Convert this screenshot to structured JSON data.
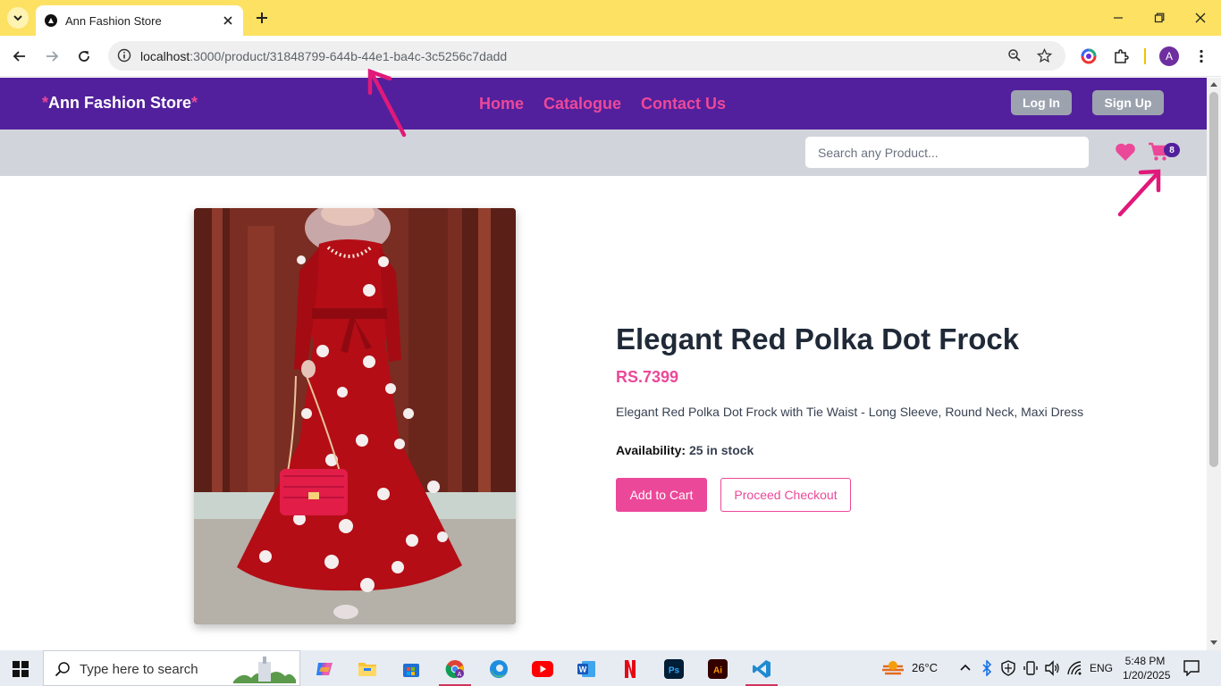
{
  "browser": {
    "tab_title": "Ann Fashion Store",
    "url_host": "localhost",
    "url_rest": ":3000/product/31848799-644b-44e1-ba4c-3c5256c7dadd",
    "profile_initial": "A"
  },
  "site": {
    "brand_star": "*",
    "brand_name": "Ann Fashion Store",
    "nav": [
      "Home",
      "Catalogue",
      "Contact Us"
    ],
    "login_label": "Log In",
    "signup_label": "Sign Up",
    "search_placeholder": "Search any Product...",
    "cart_count": "8"
  },
  "product": {
    "title": "Elegant Red Polka Dot Frock",
    "price": "RS.7399",
    "description": "Elegant Red Polka Dot Frock with Tie Waist - Long Sleeve, Round Neck, Maxi Dress",
    "availability_label": "Availability:",
    "availability_value": "25 in stock",
    "add_to_cart": "Add to Cart",
    "checkout": "Proceed Checkout"
  },
  "taskbar": {
    "search_text": "Type here to search",
    "temperature": "26°C",
    "language": "ENG",
    "time": "5:48 PM",
    "date": "1/20/2025"
  },
  "colors": {
    "brand_purple": "#52209c",
    "accent_pink": "#ec4899",
    "chrome_yellow": "#fde163"
  }
}
